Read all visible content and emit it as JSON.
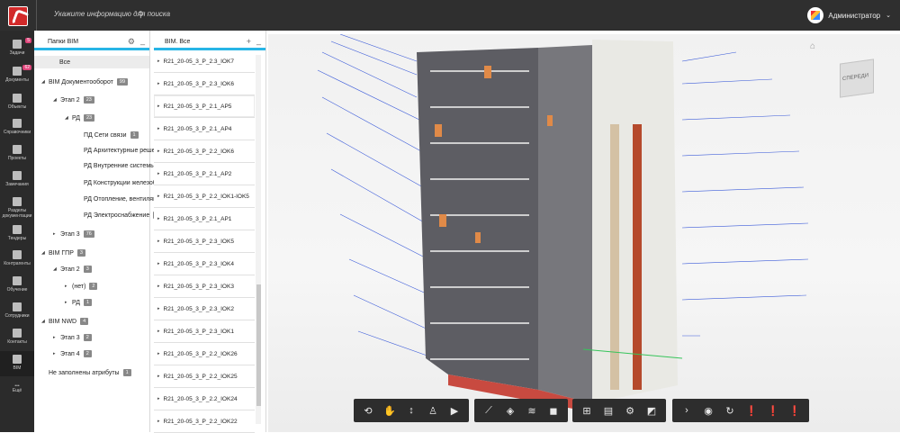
{
  "header": {
    "search_placeholder": "Укажите информацию для поиска",
    "user_name": "Администратор"
  },
  "sidebar": {
    "items": [
      {
        "label": "Задачи",
        "badge": "5",
        "icon": "tasks-icon"
      },
      {
        "label": "Документы",
        "badge": "62",
        "icon": "documents-icon"
      },
      {
        "label": "Объекты",
        "icon": "objects-icon"
      },
      {
        "label": "Справочники",
        "icon": "book-icon"
      },
      {
        "label": "Проекты",
        "icon": "projects-icon"
      },
      {
        "label": "Замечания",
        "icon": "question-icon"
      },
      {
        "label": "Разделы документации",
        "icon": "sections-icon"
      },
      {
        "label": "Тендеры",
        "icon": "tenders-icon"
      },
      {
        "label": "Контрагенты",
        "icon": "contractors-icon"
      },
      {
        "label": "Обучение",
        "icon": "bookmark-icon"
      },
      {
        "label": "Сотрудники",
        "icon": "people-icon"
      },
      {
        "label": "Контакты",
        "icon": "contacts-icon"
      },
      {
        "label": "BIM",
        "icon": "bim-icon"
      },
      {
        "label": "Ещё",
        "icon": "more-icon"
      }
    ]
  },
  "folders": {
    "title": "Папки BIM",
    "rows": [
      {
        "label": "Все",
        "indent": 0,
        "arrow": "",
        "count": ""
      },
      {
        "label": "BIM Документооборот",
        "indent": 0,
        "arrow": "◢",
        "count": "99"
      },
      {
        "label": "Этап 2",
        "indent": 1,
        "arrow": "◢",
        "count": "23"
      },
      {
        "label": "РД",
        "indent": 2,
        "arrow": "◢",
        "count": "23"
      },
      {
        "label": "ПД Сети связи",
        "indent": 3,
        "arrow": "",
        "count": "1"
      },
      {
        "label": "РД Архитектурные реше…",
        "indent": 3,
        "arrow": "",
        "count": ""
      },
      {
        "label": "РД Внутренние системы …",
        "indent": 3,
        "arrow": "",
        "count": ""
      },
      {
        "label": "РД Конструкции железоб…",
        "indent": 3,
        "arrow": "",
        "count": ""
      },
      {
        "label": "РД Отопление, вентиляц…",
        "indent": 3,
        "arrow": "",
        "count": ""
      },
      {
        "label": "РД Электроснабжение",
        "indent": 3,
        "arrow": "",
        "count": "1"
      },
      {
        "label": "Этап 3",
        "indent": 1,
        "arrow": "▸",
        "count": "76"
      },
      {
        "label": "BIM ГПР",
        "indent": 0,
        "arrow": "◢",
        "count": "3"
      },
      {
        "label": "Этап 2",
        "indent": 1,
        "arrow": "◢",
        "count": "3"
      },
      {
        "label": "(нет)",
        "indent": 2,
        "arrow": "▸",
        "count": "2"
      },
      {
        "label": "РД",
        "indent": 2,
        "arrow": "▸",
        "count": "1"
      },
      {
        "label": "BIM NWD",
        "indent": 0,
        "arrow": "◢",
        "count": "4"
      },
      {
        "label": "Этап 3",
        "indent": 1,
        "arrow": "▸",
        "count": "2"
      },
      {
        "label": "Этап 4",
        "indent": 1,
        "arrow": "▸",
        "count": "2"
      },
      {
        "label": "Не заполнены атрибуты",
        "indent": 0,
        "arrow": "",
        "count": "1"
      }
    ]
  },
  "models": {
    "title": "BIM. Все",
    "rows": [
      "R21_20-05_3_P_2.3_IOK7",
      "R21_20-05_3_P_2.3_IOK6",
      "R21_20-05_3_P_2.1_AP5",
      "R21_20-05_3_P_2.1_AP4",
      "R21_20-05_3_P_2.2_IOK6",
      "R21_20-05_3_P_2.1_AP2",
      "R21_20-05_3_P_2.2_IOK1-IOK5",
      "R21_20-05_3_P_2.1_AP1",
      "R21_20-05_3_P_2.3_IOK5",
      "R21_20-05_3_P_2.3_IOK4",
      "R21_20-05_3_P_2.3_IOK3",
      "R21_20-05_3_P_2.3_IOK2",
      "R21_20-05_3_P_2.3_IOK1",
      "R21_20-05_3_P_2.2_IOK26",
      "R21_20-05_3_P_2.2_IOK25",
      "R21_20-05_3_P_2.2_IOK24",
      "R21_20-05_3_P_2.2_IOK22"
    ]
  },
  "viewer": {
    "navcube_label": "СПЕРЕДИ"
  },
  "toolbar": {
    "groups": [
      [
        "orbit-icon",
        "hand-icon",
        "updown-icon",
        "person-icon",
        "camera-icon"
      ],
      [
        "ruler-icon",
        "section-icon",
        "layers-icon",
        "cube-icon"
      ],
      [
        "tree-icon",
        "properties-icon",
        "settings-icon",
        "fullscreen-icon"
      ],
      [
        "next-icon",
        "eye-icon",
        "refresh-icon",
        "alert-icon",
        "alert-icon",
        "alert-icon"
      ]
    ]
  },
  "colors": {
    "accent": "#27b5e6",
    "brand": "#d22a2a"
  }
}
